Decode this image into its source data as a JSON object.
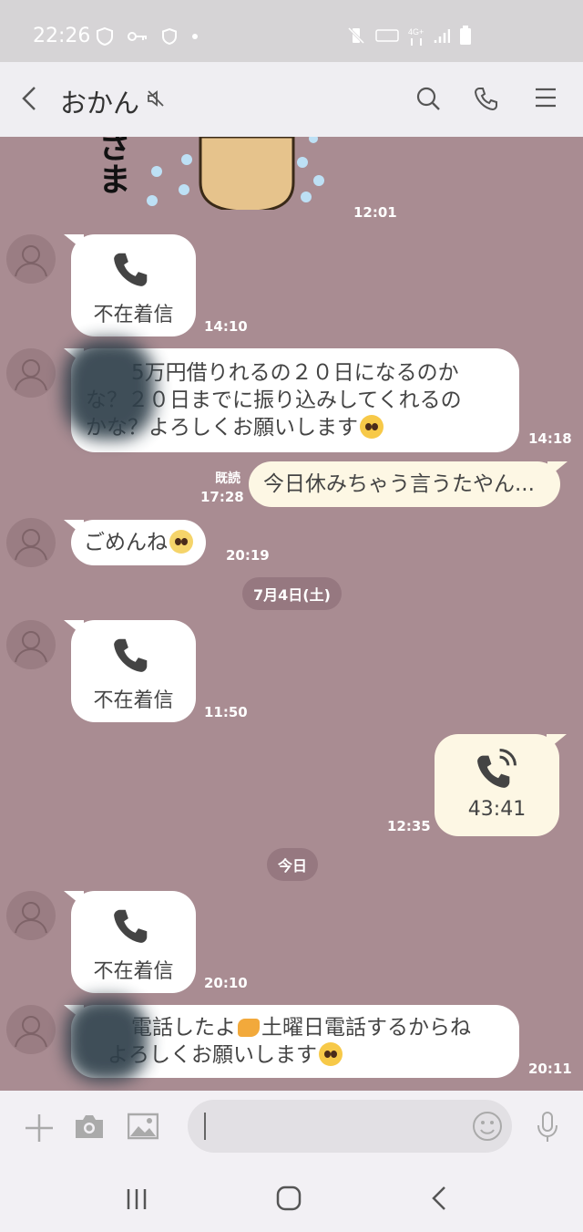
{
  "status_bar": {
    "time": "22:26"
  },
  "header": {
    "title": "おかん"
  },
  "sticker": {
    "time": "12:01",
    "text": "さま"
  },
  "messages": {
    "m1": {
      "label": "不在着信",
      "time": "14:10"
    },
    "m2": {
      "line1": "5万円借りれるの２０日になるのか",
      "line2": "な？２０日までに振り込みしてくれるの",
      "line3": "かな？よろしくお願いします",
      "time": "14:18"
    },
    "m3": {
      "read": "既読",
      "time": "17:28",
      "text": "今日休みちゃう言うたやん..."
    },
    "m4": {
      "text": "ごめんね",
      "time": "20:19"
    },
    "date1": "7月4日(土)",
    "m5": {
      "label": "不在着信",
      "time": "11:50"
    },
    "m6": {
      "duration": "43:41",
      "time": "12:35"
    },
    "date2": "今日",
    "m7": {
      "label": "不在着信",
      "time": "20:10"
    },
    "m8": {
      "line1": "電話したよ",
      "line1b": "土曜日電話するからね",
      "line2": "よろしくお願いします",
      "time": "20:11"
    }
  },
  "input_bar": {
    "placeholder": ""
  }
}
